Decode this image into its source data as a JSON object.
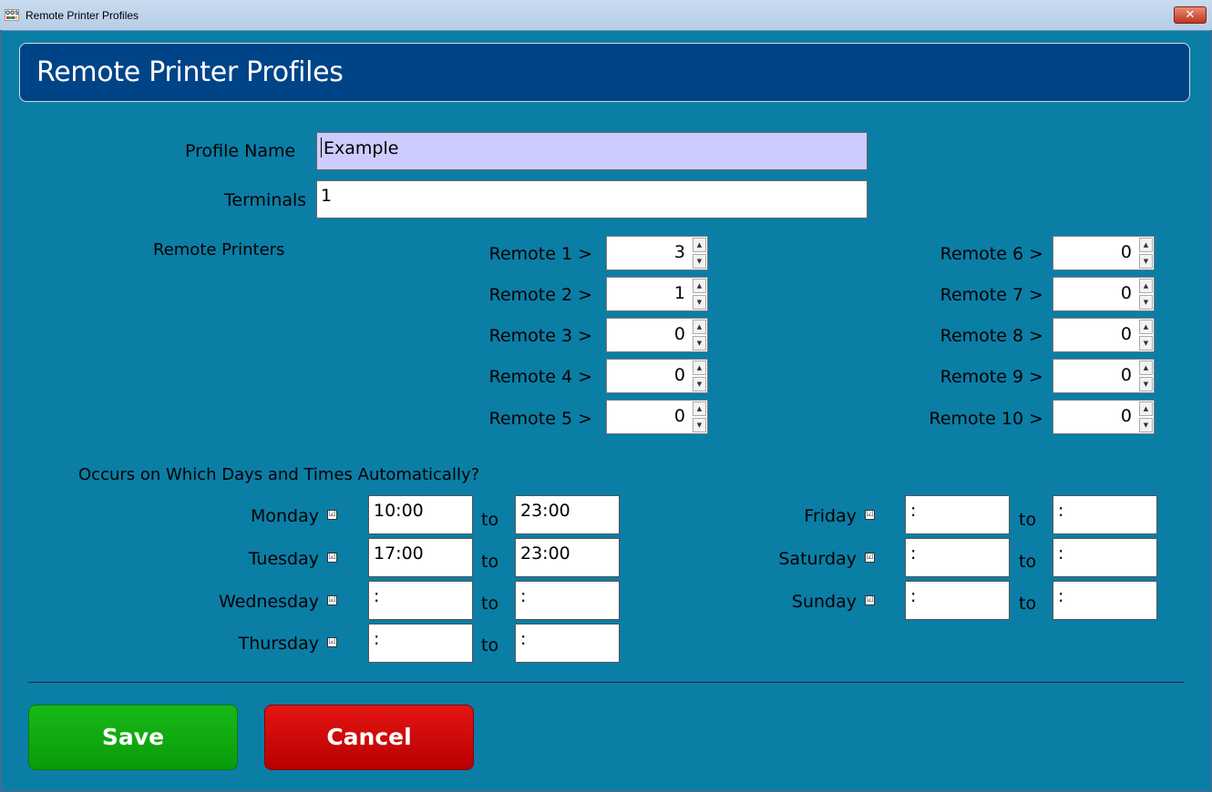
{
  "window": {
    "title": "Remote Printer Profiles",
    "icon_text": "OOS"
  },
  "header": {
    "title": "Remote Printer Profiles"
  },
  "form": {
    "profile_name_label": "Profile Name",
    "profile_name_value": "Example",
    "terminals_label": "Terminals",
    "terminals_value": "1",
    "remote_printers_label": "Remote Printers"
  },
  "remotes": [
    {
      "label": "Remote 1 >",
      "value": "3"
    },
    {
      "label": "Remote 2 >",
      "value": "1"
    },
    {
      "label": "Remote 3 >",
      "value": "0"
    },
    {
      "label": "Remote 4 >",
      "value": "0"
    },
    {
      "label": "Remote 5 >",
      "value": "0"
    },
    {
      "label": "Remote 6 >",
      "value": "0"
    },
    {
      "label": "Remote 7 >",
      "value": "0"
    },
    {
      "label": "Remote 8 >",
      "value": "0"
    },
    {
      "label": "Remote 9 >",
      "value": "0"
    },
    {
      "label": "Remote 10 >",
      "value": "0"
    }
  ],
  "schedule": {
    "heading": "Occurs on Which Days and Times Automatically?",
    "to_label": "to",
    "checkbox_glyph": "☑",
    "days": [
      {
        "day": "Monday",
        "checked": true,
        "from": "10:00",
        "to": "23:00"
      },
      {
        "day": "Tuesday",
        "checked": true,
        "from": "17:00",
        "to": "23:00"
      },
      {
        "day": "Wednesday",
        "checked": true,
        "from": " :",
        "to": " :"
      },
      {
        "day": "Thursday",
        "checked": true,
        "from": " :",
        "to": " :"
      },
      {
        "day": "Friday",
        "checked": true,
        "from": " :",
        "to": " :"
      },
      {
        "day": "Saturday",
        "checked": true,
        "from": " :",
        "to": " :"
      },
      {
        "day": "Sunday",
        "checked": true,
        "from": " :",
        "to": " :"
      }
    ]
  },
  "buttons": {
    "save": "Save",
    "cancel": "Cancel"
  },
  "colors": {
    "background": "#0b7ea6",
    "header": "#004488",
    "active_field": "#ccccff",
    "save": "#0fa80f",
    "cancel": "#d00000"
  }
}
